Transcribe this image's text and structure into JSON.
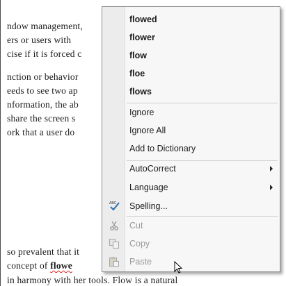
{
  "document": {
    "lines": [
      "ndow management,",
      "ers or users with",
      "cise if it is forced c",
      "nction or behavior",
      "eeds to see two ap",
      "nformation, the ab",
      "share the screen s",
      "ork that a user do",
      "so prevalent that it",
      "concept of",
      "flowe",
      "in harmony with her tools. Flow is a natural"
    ]
  },
  "menu": {
    "suggestions": [
      "flowed",
      "flower",
      "flow",
      "floe",
      "flows"
    ],
    "ignore": "Ignore",
    "ignore_all": "Ignore All",
    "add_to_dictionary": "Add to Dictionary",
    "autocorrect": "AutoCorrect",
    "language": "Language",
    "spelling": "Spelling...",
    "cut": "Cut",
    "copy": "Copy",
    "paste": "Paste",
    "icons": [
      "spelling-check-icon",
      "scissors-icon",
      "copy-icon",
      "paste-icon",
      "submenu-arrow-icon"
    ]
  }
}
